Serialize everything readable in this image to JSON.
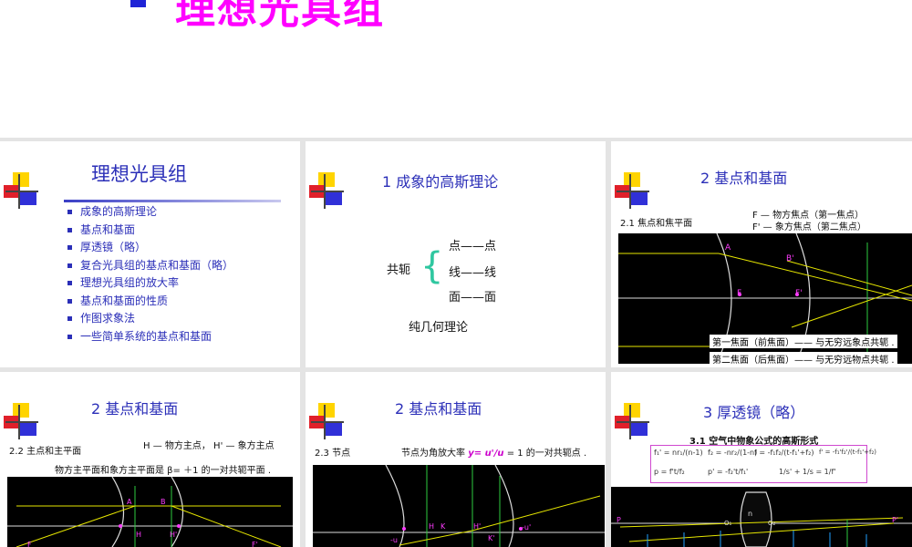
{
  "header": {
    "title": "理想光具组"
  },
  "slide1": {
    "title": "理想光具组",
    "items": [
      "成象的高斯理论",
      "基点和基面",
      "厚透镜（略）",
      "复合光具组的基点和基面（略）",
      "理想光具组的放大率",
      "基点和基面的性质",
      "作图求象法",
      "一些简单系统的基点和基面"
    ]
  },
  "slide2": {
    "title": "1   成象的高斯理论",
    "label": "共轭",
    "lines": [
      "点——点",
      "线——线",
      "面——面"
    ],
    "footer": "纯几何理论"
  },
  "slide3": {
    "title": "2   基点和基面",
    "sub": "2.1   焦点和焦平面",
    "def1": "F —   物方焦点（第一焦点）",
    "def2": "F' — 象方焦点（第二焦点）",
    "labels": {
      "A": "A",
      "B": "B'",
      "F": "F",
      "F2": "F'"
    },
    "cap1": "第一焦面（前焦面）——  与无穷远象点共轭 .",
    "cap2": "第二焦面（后焦面）——  与无穷远物点共轭 ."
  },
  "slide4": {
    "title": "2   基点和基面",
    "sub": "2.2   主点和主平面",
    "def": "H —  物方主点， H' —  象方主点",
    "desc": "物方主平面和象方主平面是  β=  ＋1  的一对共轭平面 .",
    "labels": {
      "A": "A",
      "B": "B",
      "H": "H",
      "H2": "H'",
      "F": "F",
      "F2": "F'"
    }
  },
  "slide5": {
    "title": "2   基点和基面",
    "sub": "2.3   节点",
    "desc_pre": "节点为角放大率  ",
    "desc_formula": "y= u'/u",
    "desc_post": " = 1  的一对共轭点 .",
    "labels": {
      "H": "H",
      "K": "K",
      "H2": "H'",
      "K2": "K'",
      "u": "-u",
      "u2": "-u'"
    }
  },
  "slide6": {
    "title": "3   厚透镜（略）",
    "sub": "3.1   空气中物象公式的高斯形式",
    "formulas": [
      "f₁' = nr₁/(n-1)",
      "f₂ = -nr₂/(1-n)",
      "f = -f₁f₂/(t-f₁'+f₂)",
      "f' = -f₁'f₂'/(t-f₁'+f₂)",
      "p = f't/f₂",
      "p' = -f₂'t/f₁'",
      "1/s' + 1/s = 1/f'"
    ],
    "labels": {
      "P": "P",
      "P2": "P'",
      "n": "n",
      "O1": "O₁",
      "O2": "O₂"
    }
  }
}
